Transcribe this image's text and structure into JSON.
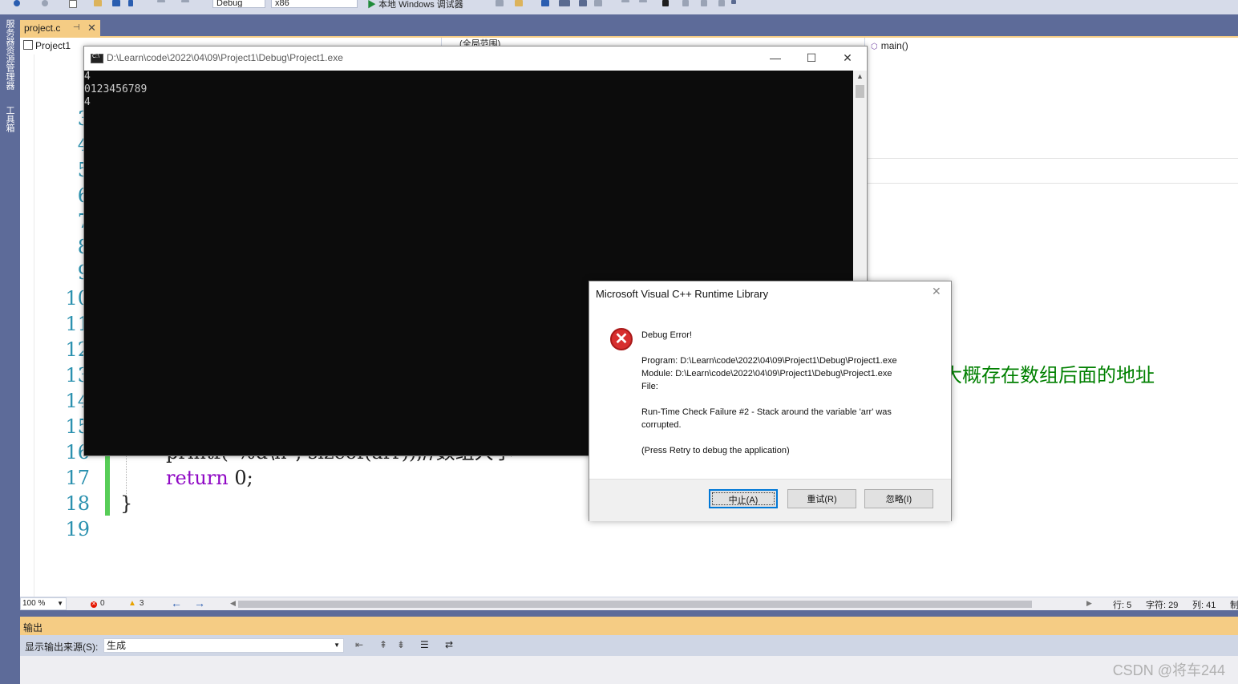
{
  "toolbar": {
    "config_value": "Debug",
    "platform_value": "x86",
    "run_label": "本地 Windows 调试器"
  },
  "side_strip": {
    "items": [
      "服务器资源管理器",
      "工具箱"
    ]
  },
  "document_tab": {
    "title": "project.c",
    "pin_glyph": "⊣",
    "close_glyph": "✕"
  },
  "nav": {
    "project": "Project1",
    "scope": "(全局范围)",
    "function": "main()"
  },
  "editor": {
    "line_numbers": [
      "3",
      "4",
      "5",
      "6",
      "7",
      "8",
      "9",
      "10",
      "11",
      "12",
      "13",
      "14",
      "15",
      "16",
      "17",
      "18",
      "19"
    ],
    "visible_comment_tail": "大概存在数组后面的地址",
    "line16_text": "printf(\"%d\\n\", sizeof(arr));//数组大小",
    "line17_keyword": "return",
    "line17_rest": " 0;",
    "line18_text": "}"
  },
  "console": {
    "title": "D:\\Learn\\code\\2022\\04\\09\\Project1\\Debug\\Project1.exe",
    "icon_text": "C:\\",
    "output_lines": [
      "4",
      "0123456789",
      "4"
    ]
  },
  "dialog": {
    "title": "Microsoft Visual C++ Runtime Library",
    "heading": "Debug Error!",
    "program": "Program: D:\\Learn\\code\\2022\\04\\09\\Project1\\Debug\\Project1.exe",
    "module": "Module: D:\\Learn\\code\\2022\\04\\09\\Project1\\Debug\\Project1.exe",
    "file": "File:",
    "failure_line1": "Run-Time Check Failure #2 - Stack around the variable 'arr' was",
    "failure_line2": "corrupted.",
    "hint": "(Press Retry to debug the application)",
    "buttons": {
      "abort": "中止(A)",
      "retry": "重试(R)",
      "ignore": "忽略(I)"
    }
  },
  "status": {
    "zoom": "100 %",
    "errors": "0",
    "warnings": "3",
    "line": "行: 5",
    "char": "字符: 29",
    "col": "列: 41",
    "more": "制"
  },
  "output_panel": {
    "title": "输出",
    "source_label": "显示输出来源(S):",
    "source_value": "生成"
  },
  "watermark": "CSDN @将车244",
  "colors": {
    "ide_frame": "#5d6b99",
    "active_tab": "#f5cc84",
    "line_number": "#2b91af",
    "keyword": "#8f08c4",
    "comment": "#008000",
    "console_bg": "#0c0c0c",
    "error_icon": "#d72e2e"
  }
}
